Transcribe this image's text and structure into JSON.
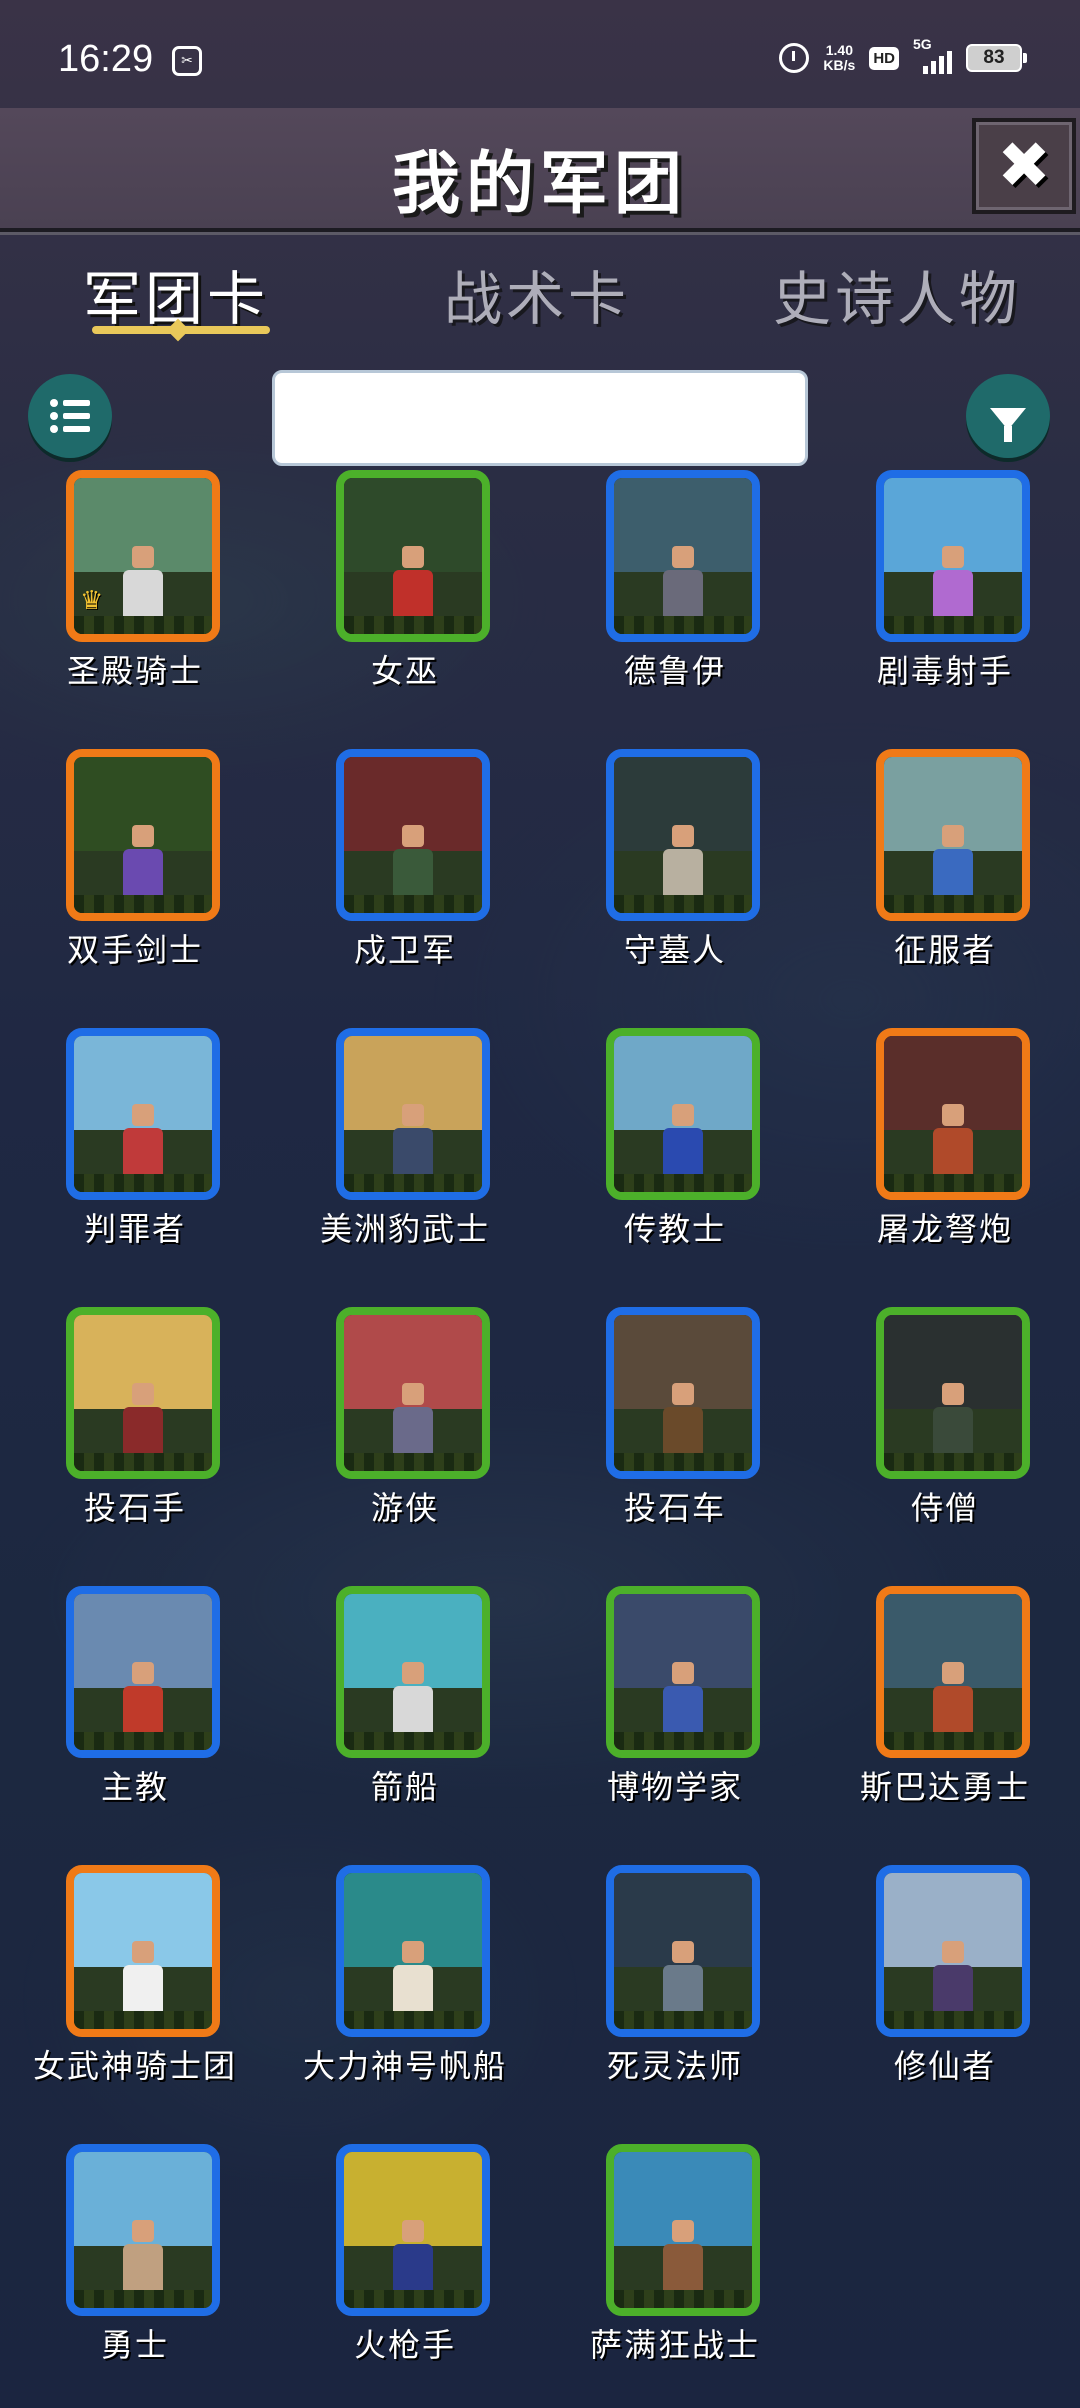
{
  "status": {
    "time": "16:29",
    "net_speed_value": "1.40",
    "net_speed_unit": "KB/s",
    "hd": "HD",
    "network": "5G",
    "battery": "83"
  },
  "header": {
    "title": "我的军团",
    "close_label": "✖"
  },
  "tabs": [
    {
      "label": "军团卡",
      "active": true
    },
    {
      "label": "战术卡",
      "active": false
    },
    {
      "label": "史诗人物",
      "active": false
    }
  ],
  "search": {
    "value": "",
    "placeholder": ""
  },
  "colors": {
    "orange": "#f07a17",
    "green": "#4cb02a",
    "blue": "#1f6de6",
    "accent_teal": "#1f6a6a",
    "tab_underline": "#e9c85a"
  },
  "cards": [
    {
      "name": "圣殿骑士",
      "rarity": "orange",
      "icon": "knight-on-horse-icon"
    },
    {
      "name": "女巫",
      "rarity": "green",
      "icon": "witch-icon"
    },
    {
      "name": "德鲁伊",
      "rarity": "blue",
      "icon": "druid-icon"
    },
    {
      "name": "剧毒射手",
      "rarity": "blue",
      "icon": "archer-icon"
    },
    {
      "name": "双手剑士",
      "rarity": "orange",
      "icon": "swordsman-icon"
    },
    {
      "name": "戍卫军",
      "rarity": "blue",
      "icon": "guard-spearman-icon"
    },
    {
      "name": "守墓人",
      "rarity": "blue",
      "icon": "tomb-keeper-icon"
    },
    {
      "name": "征服者",
      "rarity": "orange",
      "icon": "conquerors-icon"
    },
    {
      "name": "判罪者",
      "rarity": "blue",
      "icon": "judge-icon"
    },
    {
      "name": "美洲豹武士",
      "rarity": "blue",
      "icon": "jaguar-warrior-icon"
    },
    {
      "name": "传教士",
      "rarity": "green",
      "icon": "missionary-icon"
    },
    {
      "name": "屠龙弩炮",
      "rarity": "orange",
      "icon": "dragon-ballista-icon"
    },
    {
      "name": "投石手",
      "rarity": "green",
      "icon": "slinger-icon"
    },
    {
      "name": "游侠",
      "rarity": "green",
      "icon": "ranger-on-horse-icon"
    },
    {
      "name": "投石车",
      "rarity": "blue",
      "icon": "catapult-icon"
    },
    {
      "name": "侍僧",
      "rarity": "green",
      "icon": "acolyte-icon"
    },
    {
      "name": "主教",
      "rarity": "blue",
      "icon": "bishop-icon"
    },
    {
      "name": "箭船",
      "rarity": "green",
      "icon": "arrow-ship-icon"
    },
    {
      "name": "博物学家",
      "rarity": "green",
      "icon": "naturalist-icon"
    },
    {
      "name": "斯巴达勇士",
      "rarity": "orange",
      "icon": "spartan-icon"
    },
    {
      "name": "女武神骑士团",
      "rarity": "orange",
      "icon": "valkyrie-icon"
    },
    {
      "name": "大力神号帆船",
      "rarity": "blue",
      "icon": "galleon-icon"
    },
    {
      "name": "死灵法师",
      "rarity": "blue",
      "icon": "necromancer-icon"
    },
    {
      "name": "修仙者",
      "rarity": "blue",
      "icon": "cultivator-icon"
    },
    {
      "name": "勇士",
      "rarity": "blue",
      "icon": "warrior-icon"
    },
    {
      "name": "火枪手",
      "rarity": "blue",
      "icon": "musketeers-icon"
    },
    {
      "name": "萨满狂战士",
      "rarity": "green",
      "icon": "shaman-berserker-icon"
    }
  ]
}
